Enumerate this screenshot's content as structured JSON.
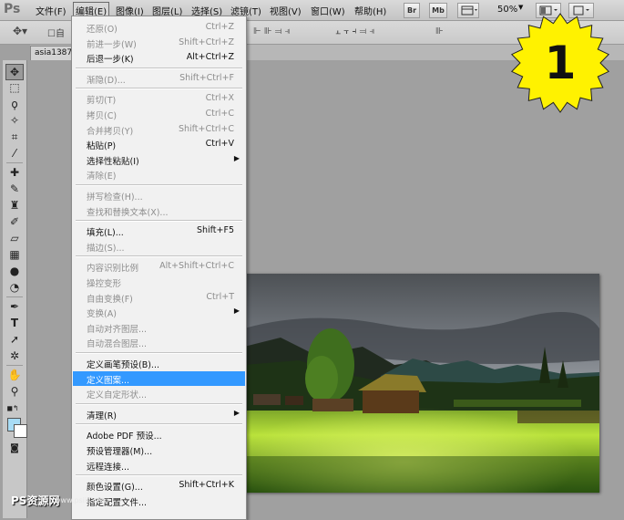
{
  "app": {
    "logo": "Ps"
  },
  "menubar": {
    "items": [
      "文件(F)",
      "编辑(E)",
      "图像(I)",
      "图层(L)",
      "选择(S)",
      "滤镜(T)",
      "视图(V)",
      "窗口(W)",
      "帮助(H)"
    ],
    "active_index": 1,
    "right_buttons": [
      "Br",
      "Mb"
    ],
    "zoom": "50%"
  },
  "document": {
    "tab_label": "asia1387"
  },
  "badge": {
    "number": "1",
    "color": "#fff200"
  },
  "edit_menu": [
    {
      "label": "还原(O)",
      "shortcut": "Ctrl+Z",
      "disabled": true
    },
    {
      "label": "前进一步(W)",
      "shortcut": "Shift+Ctrl+Z",
      "disabled": true
    },
    {
      "label": "后退一步(K)",
      "shortcut": "Alt+Ctrl+Z",
      "disabled": false
    },
    {
      "sep": true
    },
    {
      "label": "渐隐(D)...",
      "shortcut": "Shift+Ctrl+F",
      "disabled": true
    },
    {
      "sep": true
    },
    {
      "label": "剪切(T)",
      "shortcut": "Ctrl+X",
      "disabled": true
    },
    {
      "label": "拷贝(C)",
      "shortcut": "Ctrl+C",
      "disabled": true
    },
    {
      "label": "合并拷贝(Y)",
      "shortcut": "Shift+Ctrl+C",
      "disabled": true
    },
    {
      "label": "粘贴(P)",
      "shortcut": "Ctrl+V",
      "disabled": false
    },
    {
      "label": "选择性粘贴(I)",
      "shortcut": "",
      "disabled": false,
      "submenu": true
    },
    {
      "label": "清除(E)",
      "shortcut": "",
      "disabled": true
    },
    {
      "sep": true
    },
    {
      "label": "拼写检查(H)...",
      "shortcut": "",
      "disabled": true
    },
    {
      "label": "查找和替换文本(X)...",
      "shortcut": "",
      "disabled": true
    },
    {
      "sep": true
    },
    {
      "label": "填充(L)...",
      "shortcut": "Shift+F5",
      "disabled": false
    },
    {
      "label": "描边(S)...",
      "shortcut": "",
      "disabled": true
    },
    {
      "sep": true
    },
    {
      "label": "内容识别比例",
      "shortcut": "Alt+Shift+Ctrl+C",
      "disabled": true
    },
    {
      "label": "操控变形",
      "shortcut": "",
      "disabled": true
    },
    {
      "label": "自由变换(F)",
      "shortcut": "Ctrl+T",
      "disabled": true
    },
    {
      "label": "变换(A)",
      "shortcut": "",
      "disabled": true,
      "submenu": true
    },
    {
      "label": "自动对齐图层...",
      "shortcut": "",
      "disabled": true
    },
    {
      "label": "自动混合图层...",
      "shortcut": "",
      "disabled": true
    },
    {
      "sep": true
    },
    {
      "label": "定义画笔预设(B)...",
      "shortcut": "",
      "disabled": false
    },
    {
      "label": "定义图案...",
      "shortcut": "",
      "disabled": false,
      "highlighted": true
    },
    {
      "label": "定义自定形状...",
      "shortcut": "",
      "disabled": true
    },
    {
      "sep": true
    },
    {
      "label": "清理(R)",
      "shortcut": "",
      "disabled": false,
      "submenu": true
    },
    {
      "sep": true
    },
    {
      "label": "Adobe PDF 预设...",
      "shortcut": "",
      "disabled": false
    },
    {
      "label": "预设管理器(M)...",
      "shortcut": "",
      "disabled": false
    },
    {
      "label": "远程连接...",
      "shortcut": "",
      "disabled": false
    },
    {
      "sep": true
    },
    {
      "label": "颜色设置(G)...",
      "shortcut": "Shift+Ctrl+K",
      "disabled": false
    },
    {
      "label": "指定配置文件...",
      "shortcut": "",
      "disabled": false
    }
  ],
  "tools": [
    "move-tool",
    "marquee-tool",
    "lasso-tool",
    "quick-selection-tool",
    "crop-tool",
    "eyedropper-tool",
    "healing-brush-tool",
    "brush-tool",
    "clone-stamp-tool",
    "history-brush-tool",
    "eraser-tool",
    "gradient-tool",
    "blur-tool",
    "dodge-tool",
    "pen-tool",
    "type-tool",
    "path-selection-tool",
    "shape-tool",
    "3d-rotate-tool",
    "hand-tool",
    "zoom-tool"
  ],
  "colors": {
    "foreground": "#a8dcf5",
    "background": "#ffffff",
    "highlight": "#3399ff"
  },
  "watermark": {
    "text": "PS资源网",
    "sub": "www.psiis.com"
  }
}
